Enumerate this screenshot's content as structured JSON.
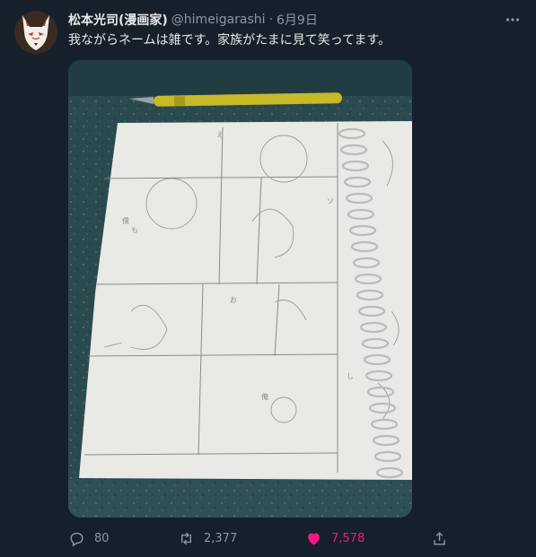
{
  "tweet": {
    "author_name": "松本光司(漫画家)",
    "handle": "@himeigarashi",
    "separator": "·",
    "date": "6月9日",
    "text": "我ながらネームは雑です。家族がたまに見て笑ってます。",
    "media": {
      "description_icon": "manga-storyboard-photo"
    },
    "stats": {
      "replies": "80",
      "retweets": "2,377",
      "likes": "7,578"
    },
    "liked": true
  },
  "colors": {
    "background": "#15202b",
    "text": "#e7e9ea",
    "secondary": "#8b98a5",
    "like": "#f91880"
  }
}
